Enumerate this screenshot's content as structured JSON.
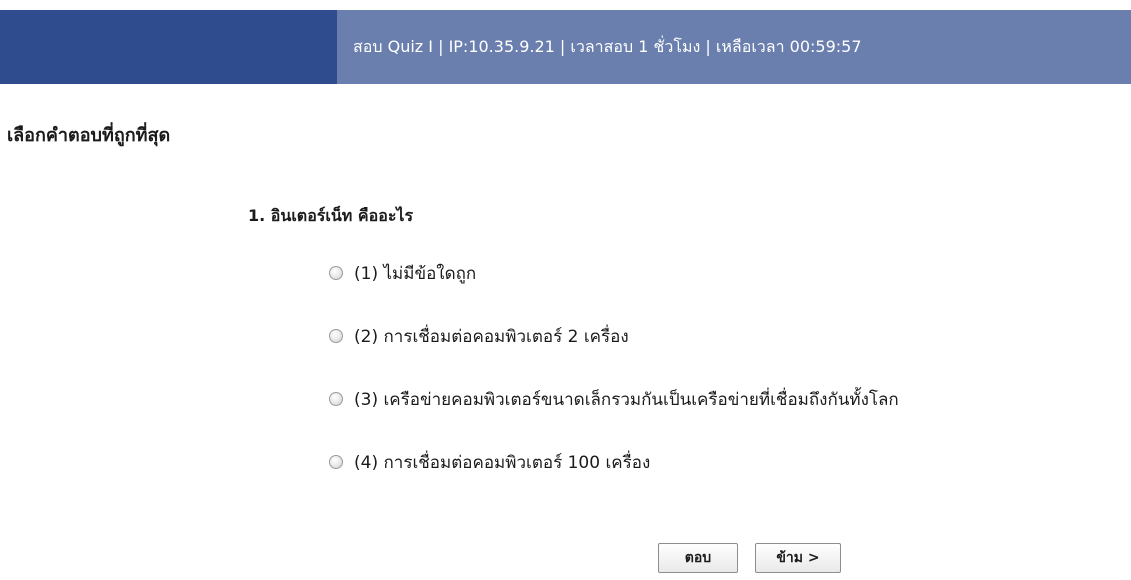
{
  "header": {
    "info": "สอบ Quiz I | IP:10.35.9.21 | เวลาสอบ 1 ชั่วโมง | เหลือเวลา 00:59:57"
  },
  "instruction": "เลือกคำตอบที่ถูกที่สุด",
  "question": {
    "text": "1. อินเตอร์เน็ท คืออะไร",
    "choices": [
      {
        "label": "(1) ไม่มีข้อใดถูก"
      },
      {
        "label": "(2) การเชื่อมต่อคอมพิวเตอร์ 2 เครื่อง"
      },
      {
        "label": "(3) เครือข่ายคอมพิวเตอร์ขนาดเล็กรวมกันเป็นเครือข่ายที่เชื่อมถึงกันทั้งโลก"
      },
      {
        "label": "(4) การเชื่อมต่อคอมพิวเตอร์ 100 เครื่อง"
      }
    ]
  },
  "buttons": {
    "answer": "ตอบ",
    "skip": "ข้าม >"
  }
}
